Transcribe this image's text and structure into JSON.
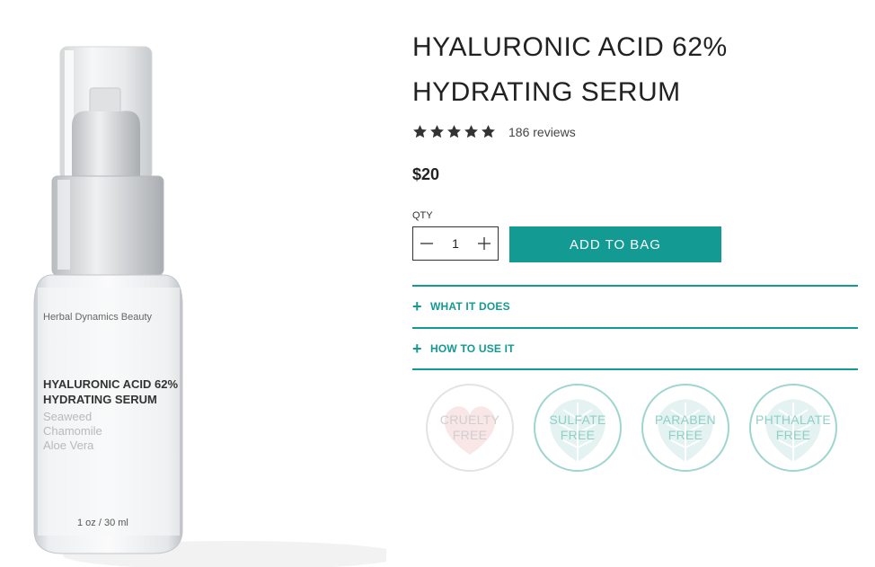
{
  "product": {
    "title": "HYALURONIC ACID 62% HYDRATING SERUM",
    "rating": 5,
    "rating_max": 5,
    "reviews_label": "186 reviews",
    "price": "$20"
  },
  "bottle_label": {
    "brand": "Herbal Dynamics Beauty",
    "title": "HYALURONIC ACID 62% HYDRATING SERUM",
    "ingredients": [
      "Seaweed",
      "Chamomile",
      "Aloe Vera"
    ],
    "size": "1 oz / 30 ml"
  },
  "purchase": {
    "qty_label": "QTY",
    "qty_value": "1",
    "add_to_bag_label": "ADD TO BAG"
  },
  "accordions": [
    {
      "label": "WHAT IT DOES"
    },
    {
      "label": "HOW TO USE IT"
    }
  ],
  "badges": [
    {
      "line1": "CRUELTY",
      "line2": "FREE",
      "color": "#e3e3e3",
      "text_color": "#cfcfcf",
      "fill": "#f9e6e6",
      "icon": "heart-icon"
    },
    {
      "line1": "SULFATE",
      "line2": "FREE",
      "color": "#9fd5cf",
      "text_color": "#8fcfc8",
      "fill": "#e4f3f1",
      "icon": "leaf-icon"
    },
    {
      "line1": "PARABEN",
      "line2": "FREE",
      "color": "#9fd5cf",
      "text_color": "#8fcfc8",
      "fill": "#e4f3f1",
      "icon": "leaf-icon"
    },
    {
      "line1": "PHTHALATE",
      "line2": "FREE",
      "color": "#9fd5cf",
      "text_color": "#8fcfc8",
      "fill": "#e4f3f1",
      "icon": "leaf-icon"
    }
  ],
  "colors": {
    "accent": "#139a92",
    "star": "#333333"
  }
}
